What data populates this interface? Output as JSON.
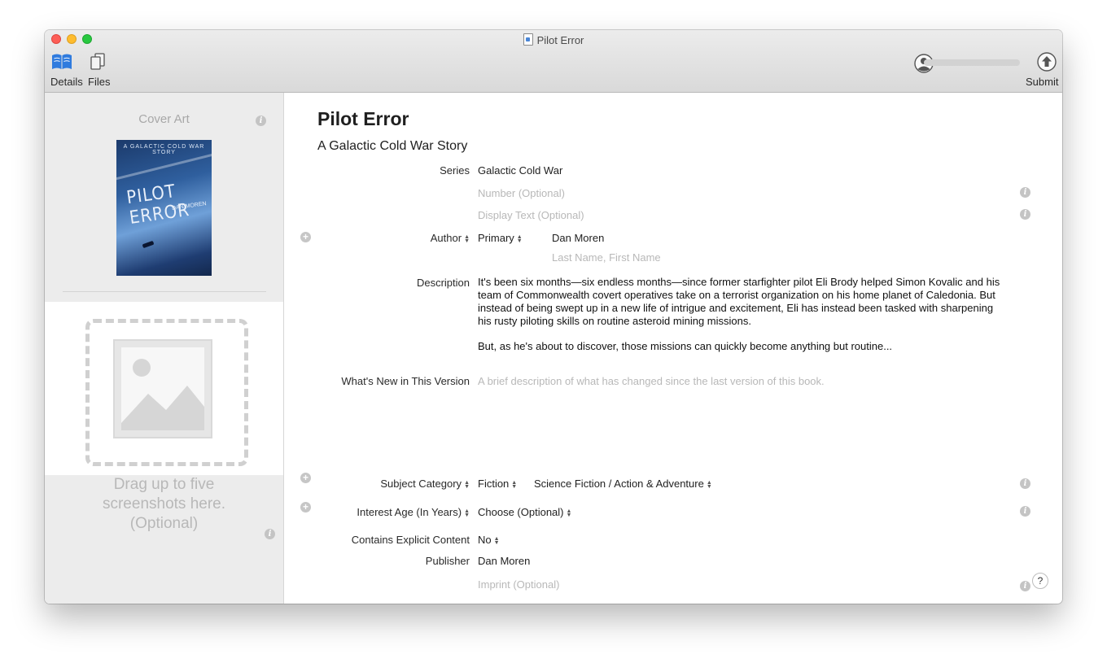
{
  "window": {
    "title": "Pilot Error"
  },
  "toolbar": {
    "details_label": "Details",
    "files_label": "Files",
    "submit_label": "Submit",
    "upload_progress": 0
  },
  "sidebar": {
    "cover_label": "Cover Art",
    "cover_image": {
      "kicker": "A GALACTIC COLD WAR STORY",
      "title": "PILOT ERROR",
      "author": "DAN MOREN"
    },
    "screenshot_hint": "Drag up to five screenshots here. (Optional)"
  },
  "book": {
    "title": "Pilot Error",
    "subtitle": "A Galactic Cold War Story"
  },
  "fields": {
    "series_label": "Series",
    "series_value": "Galactic Cold War",
    "number_placeholder": "Number (Optional)",
    "display_text_placeholder": "Display Text (Optional)",
    "author_label": "Author",
    "author_role": "Primary",
    "author_name": "Dan Moren",
    "author_sort_placeholder": "Last Name, First Name",
    "description_label": "Description",
    "description_p1": "It's been six months—six endless months—since former starfighter pilot Eli Brody helped Simon Kovalic and his team of Commonwealth covert operatives take on a terrorist organization on his home planet of Caledonia. But instead of being swept up in a new life of intrigue and excitement, Eli has instead been tasked with sharpening his rusty piloting skills on routine asteroid mining missions.",
    "description_p2": "But, as he's about to discover, those missions can quickly become anything but routine...",
    "whats_new_label": "What's New in This Version",
    "whats_new_placeholder": "A brief description of what has changed since the last version of this book.",
    "subject_label": "Subject Category",
    "subject_primary": "Fiction",
    "subject_secondary": "Science Fiction / Action & Adventure",
    "age_label": "Interest Age (In Years)",
    "age_value": "Choose (Optional)",
    "explicit_label": "Contains Explicit Content",
    "explicit_value": "No",
    "publisher_label": "Publisher",
    "publisher_value": "Dan Moren",
    "imprint_placeholder": "Imprint (Optional)"
  },
  "help": {
    "label": "?"
  },
  "colors": {
    "accent": "#2f7bde",
    "placeholder": "#b8b8b8",
    "sidebar_bg": "#ececec"
  }
}
